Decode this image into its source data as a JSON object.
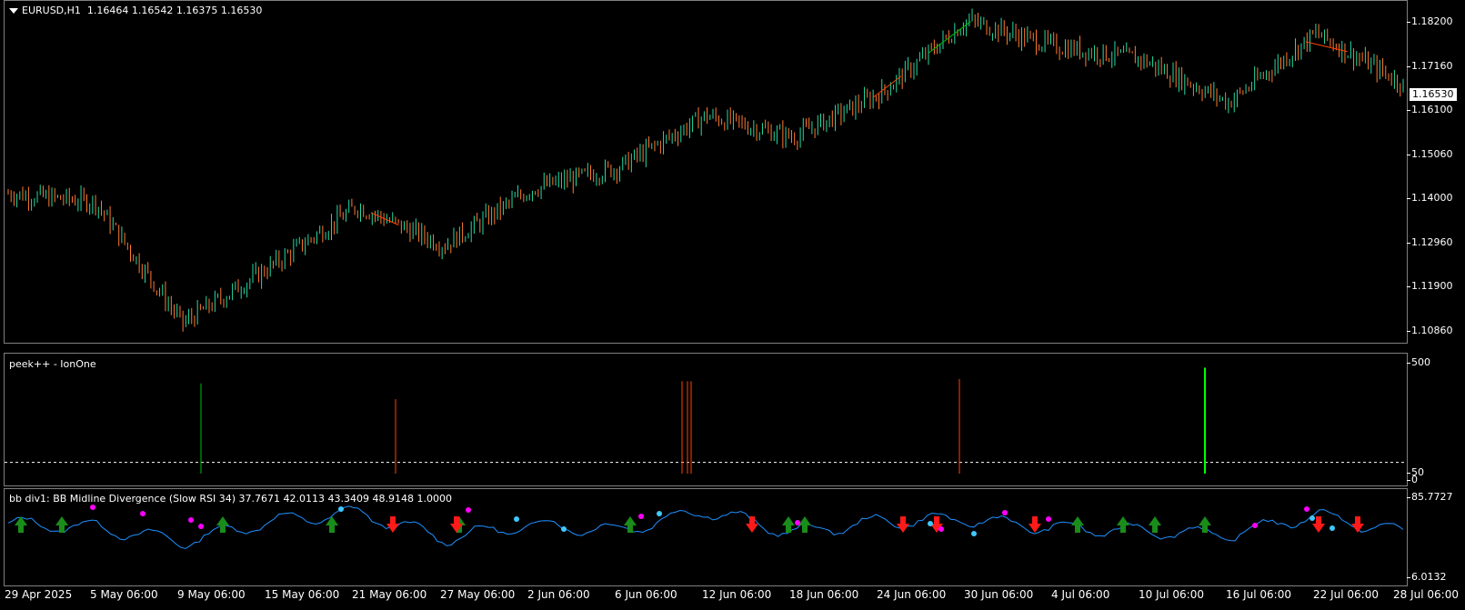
{
  "main": {
    "symbol_label": "EURUSD,H1",
    "ohlc": "1.16464 1.16542 1.16375 1.16530",
    "current_price": "1.16530",
    "price_ticks": [
      "1.18200",
      "1.17160",
      "1.16100",
      "1.15060",
      "1.14000",
      "1.12960",
      "1.11900",
      "1.10860"
    ]
  },
  "peek": {
    "label": "peek++ - IonOne",
    "ticks": [
      "500",
      "50",
      "0"
    ]
  },
  "div": {
    "label": "bb div1: BB Midline Divergence (Slow RSI 34) 37.7671 42.0113 43.3409 48.9148 1.0000",
    "ticks": [
      "85.7727",
      "6.0132"
    ]
  },
  "time_labels": [
    "29 Apr 2025",
    "5 May 06:00",
    "9 May 06:00",
    "15 May 06:00",
    "21 May 06:00",
    "27 May 06:00",
    "2 Jun 06:00",
    "6 Jun 06:00",
    "12 Jun 06:00",
    "18 Jun 06:00",
    "24 Jun 06:00",
    "30 Jun 06:00",
    "4 Jul 06:00",
    "10 Jul 06:00",
    "16 Jul 06:00",
    "22 Jul 06:00",
    "28 Jul 06:00"
  ],
  "chart_data": [
    {
      "type": "line",
      "title": "EURUSD,H1",
      "ylim": [
        1.1055,
        1.1845
      ],
      "x": [
        "29 Apr 2025",
        "5 May 06:00",
        "9 May 06:00",
        "15 May 06:00",
        "21 May 06:00",
        "27 May 06:00",
        "2 Jun 06:00",
        "6 Jun 06:00",
        "12 Jun 06:00",
        "18 Jun 06:00",
        "24 Jun 06:00",
        "30 Jun 06:00",
        "4 Jul 06:00",
        "10 Jul 06:00",
        "16 Jul 06:00",
        "22 Jul 06:00",
        "28 Jul 06:00"
      ],
      "series": [
        {
          "values": [
            1.14,
            1.138,
            1.11,
            1.123,
            1.137,
            1.128,
            1.141,
            1.146,
            1.158,
            1.153,
            1.163,
            1.18,
            1.174,
            1.171,
            1.161,
            1.177,
            1.1653
          ]
        }
      ]
    },
    {
      "type": "bar",
      "title": "peek++ - IonOne",
      "ylim": [
        0,
        500
      ],
      "x": [
        "9 May 06:00",
        "21 May 06:00",
        "11 Jun",
        "11 Jun",
        "11 Jun",
        "28 Jun",
        "16 Jul 06:00"
      ],
      "values": [
        400,
        330,
        410,
        410,
        410,
        420,
        470
      ],
      "colors": [
        "#00c000",
        "#ff4500",
        "#ff4500",
        "#ff4500",
        "#ff4500",
        "#ff4500",
        "#00ff00"
      ]
    },
    {
      "type": "line",
      "title": "bb div1: BB Midline Divergence (Slow RSI 34)",
      "ylim": [
        6.0132,
        85.7727
      ],
      "x": [
        "29 Apr 2025",
        "5 May 06:00",
        "9 May 06:00",
        "15 May 06:00",
        "21 May 06:00",
        "27 May 06:00",
        "2 Jun 06:00",
        "6 Jun 06:00",
        "12 Jun 06:00",
        "18 Jun 06:00",
        "24 Jun 06:00",
        "30 Jun 06:00",
        "4 Jul 06:00",
        "10 Jul 06:00",
        "16 Jul 06:00",
        "22 Jul 06:00",
        "28 Jul 06:00"
      ],
      "series": [
        {
          "values": [
            58,
            55,
            42,
            60,
            68,
            45,
            57,
            52,
            70,
            50,
            60,
            62,
            54,
            52,
            48,
            66,
            50
          ]
        }
      ]
    }
  ]
}
